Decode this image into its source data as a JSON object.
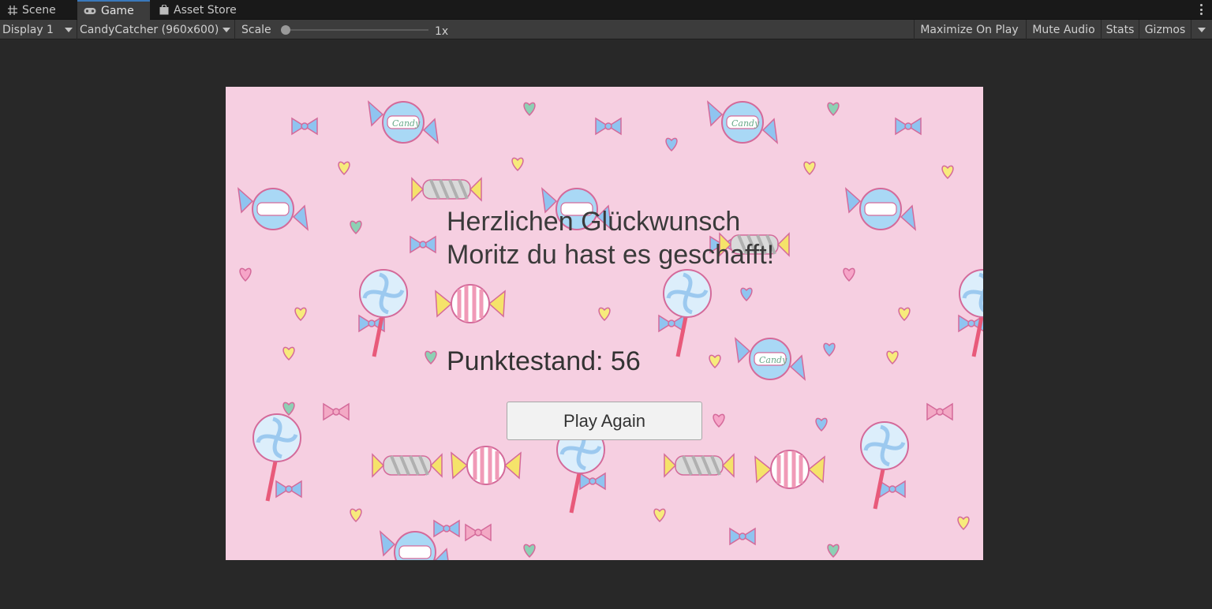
{
  "tabs": [
    {
      "label": "Scene",
      "icon": "grid-icon",
      "active": false
    },
    {
      "label": "Game",
      "icon": "gamepad-icon",
      "active": true
    },
    {
      "label": "Asset Store",
      "icon": "shopping-bag-icon",
      "active": false
    }
  ],
  "toolbar": {
    "display": "Display 1",
    "resolution": "CandyCatcher (960x600)",
    "scale_label": "Scale",
    "scale_value": "1x",
    "maximize_on_play": "Maximize On Play",
    "mute_audio": "Mute Audio",
    "stats": "Stats",
    "gizmos": "Gizmos"
  },
  "game": {
    "congrats_text": "Herzlichen Glückwunsch Moritz du hast es geschafft!",
    "score_text": "Punktestand: 56",
    "play_again": "Play Again",
    "background_color": "#f6cfe1",
    "candy_label": "Candy"
  },
  "colors": {
    "editor_bg": "#282828",
    "toolbar_bg": "#3c3c3c",
    "accent": "#3a79bb"
  }
}
